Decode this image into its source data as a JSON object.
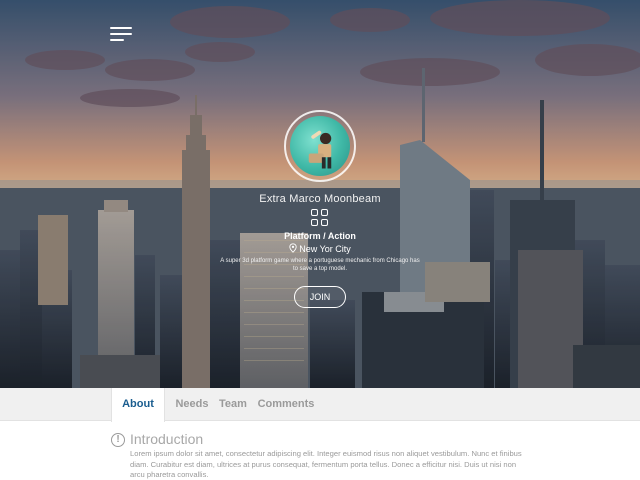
{
  "hero": {
    "menu_icon": "hamburger-menu-icon",
    "avatar_icon": "person-running-avatar",
    "title": "Extra Marco Moonbeam",
    "genre_icon": "grid-four-squares-icon",
    "genre": "Platform / Action",
    "location_icon": "map-pin-icon",
    "location": "New Yor City",
    "description": "A super 3d platform game where a portuguese mechanic from Chicago has to save a top model.",
    "join_label": "JOIN"
  },
  "tabs": [
    {
      "label": "About",
      "active": true
    },
    {
      "label": "Needs",
      "active": false
    },
    {
      "label": "Team",
      "active": false
    },
    {
      "label": "Comments",
      "active": false
    }
  ],
  "content": {
    "section_icon": "info-circle-icon",
    "section_title": "Introduction",
    "body": "Lorem ipsum dolor sit amet, consectetur adipiscing elit. Integer euismod risus non aliquet vestibulum. Nunc et finibus diam. Curabitur est diam, ultrices at purus consequat, fermentum porta tellus. Donec a efficitur nisi. Duis ut nisi non arcu pharetra convallis."
  },
  "colors": {
    "accent": "#1a5d8f",
    "tab_background": "#f0f0f0",
    "muted_text": "#9a9a9a"
  }
}
